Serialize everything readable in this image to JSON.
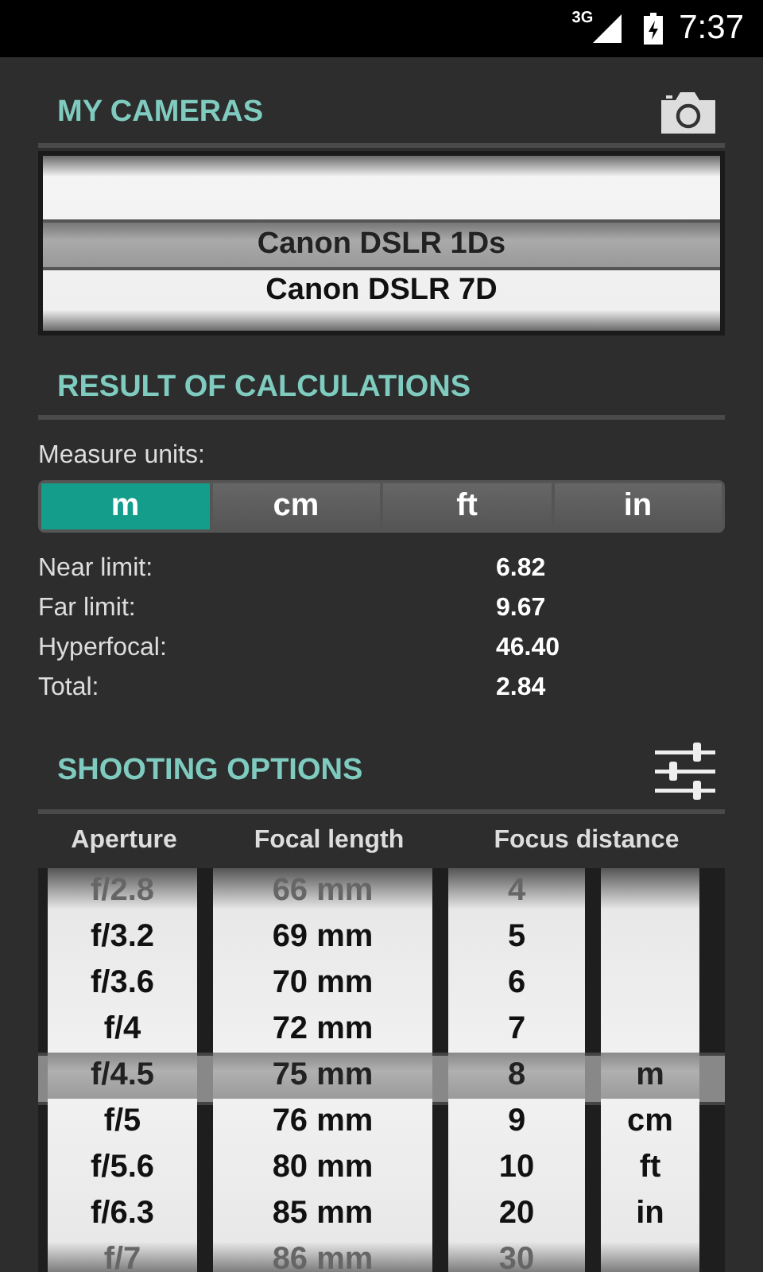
{
  "status_bar": {
    "network": "3G",
    "time": "7:37"
  },
  "cameras": {
    "title": "MY CAMERAS",
    "items": [
      {
        "label": "Canon DSLR 1Ds",
        "selected": true
      },
      {
        "label": "Canon DSLR 7D",
        "selected": false
      }
    ]
  },
  "results": {
    "title": "RESULT OF CALCULATIONS",
    "units_label": "Measure units:",
    "units": [
      {
        "label": "m",
        "selected": true
      },
      {
        "label": "cm",
        "selected": false
      },
      {
        "label": "ft",
        "selected": false
      },
      {
        "label": "in",
        "selected": false
      }
    ],
    "rows": [
      {
        "label": "Near limit:",
        "value": "6.82"
      },
      {
        "label": "Far limit:",
        "value": "9.67"
      },
      {
        "label": "Hyperfocal:",
        "value": "46.40"
      },
      {
        "label": "Total:",
        "value": "2.84"
      }
    ]
  },
  "shooting": {
    "title": "SHOOTING OPTIONS",
    "columns": [
      "Aperture",
      "Focal length",
      "Focus distance"
    ],
    "wheels": [
      {
        "items": [
          {
            "label": "f/2.8",
            "selected": false
          },
          {
            "label": "f/3.2",
            "selected": false
          },
          {
            "label": "f/3.6",
            "selected": false
          },
          {
            "label": "f/4",
            "selected": false
          },
          {
            "label": "f/4.5",
            "selected": true
          },
          {
            "label": "f/5",
            "selected": false
          },
          {
            "label": "f/5.6",
            "selected": false
          },
          {
            "label": "f/6.3",
            "selected": false
          },
          {
            "label": "f/7",
            "selected": false
          }
        ]
      },
      {
        "items": [
          {
            "label": "66 mm",
            "selected": false
          },
          {
            "label": "69 mm",
            "selected": false
          },
          {
            "label": "70 mm",
            "selected": false
          },
          {
            "label": "72 mm",
            "selected": false
          },
          {
            "label": "75 mm",
            "selected": true
          },
          {
            "label": "76 mm",
            "selected": false
          },
          {
            "label": "80 mm",
            "selected": false
          },
          {
            "label": "85 mm",
            "selected": false
          },
          {
            "label": "86 mm",
            "selected": false
          }
        ]
      },
      {
        "items": [
          {
            "label": "4",
            "selected": false
          },
          {
            "label": "5",
            "selected": false
          },
          {
            "label": "6",
            "selected": false
          },
          {
            "label": "7",
            "selected": false
          },
          {
            "label": "8",
            "selected": true
          },
          {
            "label": "9",
            "selected": false
          },
          {
            "label": "10",
            "selected": false
          },
          {
            "label": "20",
            "selected": false
          },
          {
            "label": "30",
            "selected": false
          }
        ]
      },
      {
        "items": [
          {
            "label": "m",
            "selected": true
          },
          {
            "label": "cm",
            "selected": false
          },
          {
            "label": "ft",
            "selected": false
          },
          {
            "label": "in",
            "selected": false
          }
        ]
      }
    ]
  }
}
